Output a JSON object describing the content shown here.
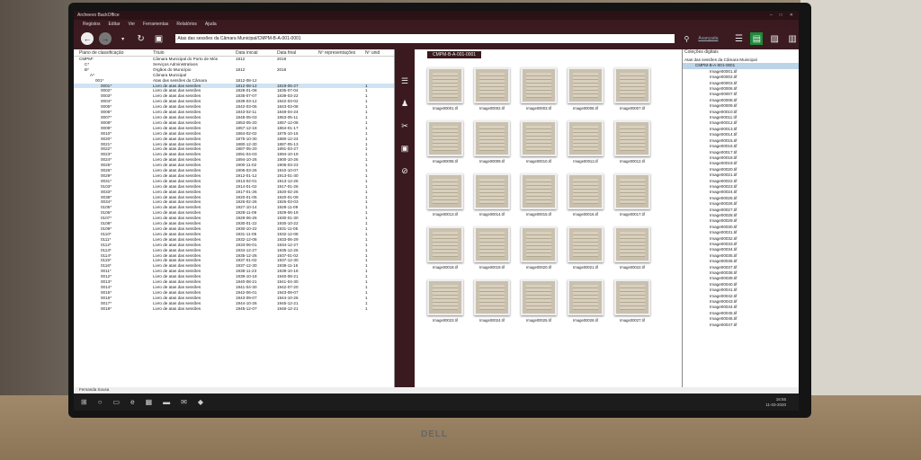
{
  "window": {
    "title": "Archeevo BackOffice",
    "controls": [
      "–",
      "□",
      "✕"
    ]
  },
  "menu": [
    "Registos",
    "Editar",
    "Ver",
    "Ferramentas",
    "Relatórios",
    "Ajuda"
  ],
  "toolbar": {
    "address": "Atas das sessões da Câmara Municipal/CMPM-B-A-001-0001",
    "advanced": "Avançada"
  },
  "tree": {
    "headers": [
      "Plano de classificação",
      "Título",
      "Data inicial",
      "Data final",
      "Nº representações",
      "Nº unid"
    ],
    "rows": [
      [
        "CMPM*",
        "Câmara Municipal do Porto de Mós",
        "1812",
        "2018",
        "",
        ""
      ],
      [
        "C*",
        "Serviços Administrativos",
        "",
        "",
        "",
        ""
      ],
      [
        "B*",
        "Órgãos do Município",
        "1812",
        "2018",
        "",
        ""
      ],
      [
        "A*",
        "Câmara Municipal",
        "",
        "",
        "",
        ""
      ],
      [
        "001*",
        "Atas das sessões da Câmara",
        "1812-08-12",
        "",
        "",
        ""
      ],
      [
        "0001*",
        "Livro de atas das sessões",
        "1812-08-12",
        "1819-05-27",
        "",
        "1"
      ],
      [
        "0002*",
        "Livro de atas das sessões",
        "1828-01-08",
        "1835-07-04",
        "",
        "1"
      ],
      [
        "0003*",
        "Livro de atas das sessões",
        "1835-07-07",
        "1839-03-22",
        "",
        "1"
      ],
      [
        "0004*",
        "Livro de atas das sessões",
        "1839-03-12",
        "1842-03-02",
        "",
        "1"
      ],
      [
        "0005*",
        "Livro de atas das sessões",
        "1842-03-05",
        "1843-03-08",
        "",
        "1"
      ],
      [
        "0006*",
        "Livro de atas das sessões",
        "1843-02-11",
        "1848-04-24",
        "",
        "1"
      ],
      [
        "0007*",
        "Livro de atas das sessões",
        "1848-05-03",
        "1853-05-11",
        "",
        "1"
      ],
      [
        "0008*",
        "Livro de atas das sessões",
        "1853-05-20",
        "1857-12-08",
        "",
        "1"
      ],
      [
        "0009*",
        "Livro de atas das sessões",
        "1857-12-18",
        "1864-01-17",
        "",
        "1"
      ],
      [
        "0010*",
        "Livro de atas das sessões",
        "1864-02-02",
        "1875-10-15",
        "",
        "1"
      ],
      [
        "0020*",
        "Livro de atas das sessões",
        "1875-10-30",
        "1880-12-24",
        "",
        "1"
      ],
      [
        "0021*",
        "Livro de atas das sessões",
        "1880-12-30",
        "1887-05-13",
        "",
        "1"
      ],
      [
        "0022*",
        "Livro de atas das sessões",
        "1887-05-20",
        "1891-03-27",
        "",
        "1"
      ],
      [
        "0023*",
        "Livro de atas das sessões",
        "1891-04-03",
        "1894-10-19",
        "",
        "1"
      ],
      [
        "0024*",
        "Livro de atas das sessões",
        "1894-10-26",
        "1900-10-26",
        "",
        "1"
      ],
      [
        "0025*",
        "Livro de atas das sessões",
        "1900-11-02",
        "1906-03-23",
        "",
        "1"
      ],
      [
        "0026*",
        "Livro de atas das sessões",
        "1906-03-26",
        "1910-10-07",
        "",
        "1"
      ],
      [
        "0029*",
        "Livro de atas das sessões",
        "1912-01-12",
        "1913-01-30",
        "",
        "1"
      ],
      [
        "0031*",
        "Livro de atas das sessões",
        "1913-02-01",
        "1913-12-26",
        "",
        "1"
      ],
      [
        "0103*",
        "Livro de atas das sessões",
        "1914-01-02",
        "1917-01-26",
        "",
        "1"
      ],
      [
        "0033*",
        "Livro de atas das sessões",
        "1917-01-26",
        "1920-02-26",
        "",
        "1"
      ],
      [
        "0038*",
        "Livro de atas das sessões",
        "1920-01-05",
        "1920-01-09",
        "",
        "1"
      ],
      [
        "0034*",
        "Livro de atas das sessões",
        "1926-02-26",
        "1926-03-03",
        "",
        "1"
      ],
      [
        "0105*",
        "Livro de atas das sessões",
        "1927-10-14",
        "1928-11-09",
        "",
        "1"
      ],
      [
        "0106*",
        "Livro de atas das sessões",
        "1928-11-09",
        "1929-06-19",
        "",
        "1"
      ],
      [
        "0107*",
        "Livro de atas das sessões",
        "1929-06-26",
        "1930-01-30",
        "",
        "1"
      ],
      [
        "0108*",
        "Livro de atas das sessões",
        "1930-01-22",
        "1930-10-22",
        "",
        "1"
      ],
      [
        "0109*",
        "Livro de atas das sessões",
        "1930-10-22",
        "1931-11-05",
        "",
        "1"
      ],
      [
        "0110*",
        "Livro de atas das sessões",
        "1931-11-05",
        "1932-12-08",
        "",
        "1"
      ],
      [
        "0111*",
        "Livro de atas das sessões",
        "1932-12-08",
        "1933-06-29",
        "",
        "1"
      ],
      [
        "0112*",
        "Livro de atas das sessões",
        "1933-06-01",
        "1934-12-27",
        "",
        "1"
      ],
      [
        "0113*",
        "Livro de atas das sessões",
        "1934-12-27",
        "1935-12-26",
        "",
        "1"
      ],
      [
        "0114*",
        "Livro de atas das sessões",
        "1935-12-26",
        "1937-01-02",
        "",
        "1"
      ],
      [
        "0115*",
        "Livro de atas das sessões",
        "1937-01-02",
        "1937-12-30",
        "",
        "1"
      ],
      [
        "0116*",
        "Livro de atas das sessões",
        "1937-12-30",
        "1938-11-16",
        "",
        "1"
      ],
      [
        "0011*",
        "Livro de atas das sessões",
        "1938-11-23",
        "1939-10-18",
        "",
        "1"
      ],
      [
        "0012*",
        "Livro de atas das sessões",
        "1939-10-18",
        "1940-08-21",
        "",
        "1"
      ],
      [
        "0013*",
        "Livro de atas das sessões",
        "1940-08-21",
        "1941-04-30",
        "",
        "1"
      ],
      [
        "0014*",
        "Livro de atas das sessões",
        "1941-04-30",
        "1942-07-20",
        "",
        "1"
      ],
      [
        "0015*",
        "Livro de atas das sessões",
        "1942-06-01",
        "1943-09-07",
        "",
        "1"
      ],
      [
        "0016*",
        "Livro de atas das sessões",
        "1943-09-07",
        "1944-10-26",
        "",
        "1"
      ],
      [
        "0017*",
        "Livro de atas das sessões",
        "1944-10-26",
        "1945-12-21",
        "",
        "1"
      ],
      [
        "0018*",
        "Livro de atas das sessões",
        "1945-12-07",
        "1946-12-21",
        "",
        "1"
      ]
    ]
  },
  "center": {
    "tab": "CMPM-B-A-001-0001",
    "thumbs": [
      "Image00001.tif",
      "Image00002.tif",
      "Image00003.tif",
      "Image00006.tif",
      "Image00007.tif",
      "Image00008.tif",
      "Image00009.tif",
      "Image00010.tif",
      "Image00011.tif",
      "Image00012.tif",
      "Image00013.tif",
      "Image00014.tif",
      "Image00015.tif",
      "Image00016.tif",
      "Image00017.tif",
      "Image00018.tif",
      "Image00019.tif",
      "Image00020.tif",
      "Image00021.tif",
      "Image00022.tif",
      "Image00023.tif",
      "Image00024.tif",
      "Image00025.tif",
      "Image00026.tif",
      "Image00027.tif"
    ]
  },
  "right": {
    "header": "Coleções digitais",
    "root": "Atas das sessões da Câmara Municipal",
    "selected": "CMPM-B-A-001-0001",
    "items": [
      "Image00001.tif",
      "Image00002.tif",
      "Image00003.tif",
      "Image00006.tif",
      "Image00007.tif",
      "Image00008.tif",
      "Image00009.tif",
      "Image00010.tif",
      "Image00011.tif",
      "Image00012.tif",
      "Image00013.tif",
      "Image00014.tif",
      "Image00015.tif",
      "Image00016.tif",
      "Image00017.tif",
      "Image00018.tif",
      "Image00019.tif",
      "Image00020.tif",
      "Image00021.tif",
      "Image00022.tif",
      "Image00023.tif",
      "Image00024.tif",
      "Image00025.tif",
      "Image00026.tif",
      "Image00027.tif",
      "Image00028.tif",
      "Image00029.tif",
      "Image00030.tif",
      "Image00031.tif",
      "Image00032.tif",
      "Image00033.tif",
      "Image00034.tif",
      "Image00035.tif",
      "Image00036.tif",
      "Image00037.tif",
      "Image00038.tif",
      "Image00039.tif",
      "Image00040.tif",
      "Image00041.tif",
      "Image00042.tif",
      "Image00043.tif",
      "Image00044.tif",
      "Image00045.tif",
      "Image00046.tif",
      "Image00047.tif"
    ]
  },
  "status": {
    "user": "Fernanda Sousa",
    "time": "16:55",
    "date": "11-03-2020"
  },
  "monitor": {
    "brand": "DELL"
  }
}
